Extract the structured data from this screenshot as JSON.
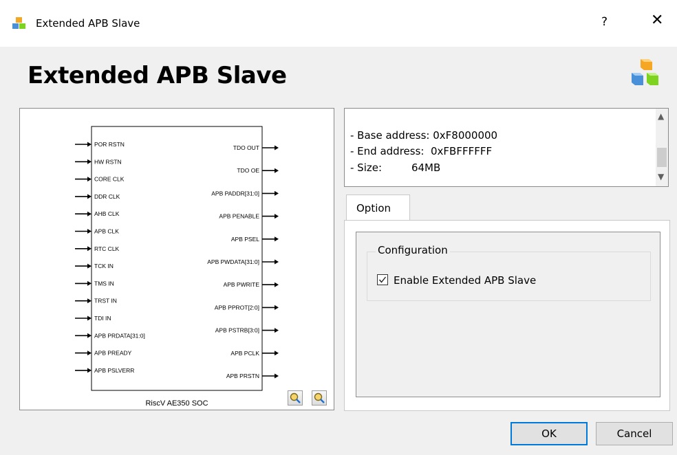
{
  "window": {
    "title": "Extended APB Slave",
    "help_label": "?",
    "close_label": "✕"
  },
  "header": {
    "title": "Extended APB Slave"
  },
  "symbol": {
    "name": "RiscV AE350 SOC",
    "inputs": [
      "POR RSTN",
      "HW RSTN",
      "CORE CLK",
      "DDR CLK",
      "AHB CLK",
      "APB CLK",
      "RTC CLK",
      "TCK IN",
      "TMS IN",
      "TRST IN",
      "TDI IN",
      "APB PRDATA[31:0]",
      "APB PREADY",
      "APB PSLVERR"
    ],
    "outputs": [
      "TDO OUT",
      "TDO OE",
      "APB PADDR[31:0]",
      "APB PENABLE",
      "APB PSEL",
      "APB PWDATA[31:0]",
      "APB PWRITE",
      "APB PPROT[2:0]",
      "APB PSTRB[3:0]",
      "APB PCLK",
      "APB PRSTN"
    ]
  },
  "info": {
    "lines": [
      "- Base address: 0xF8000000",
      "- End address:  0xFBFFFFFF",
      "- Size:         64MB"
    ]
  },
  "tabs": [
    {
      "label": "Option"
    }
  ],
  "configuration": {
    "group_title": "Configuration",
    "enable_label": "Enable Extended APB Slave",
    "enable_checked": true
  },
  "buttons": {
    "ok": "OK",
    "cancel": "Cancel"
  },
  "colors": {
    "accent": "#0078d7"
  }
}
